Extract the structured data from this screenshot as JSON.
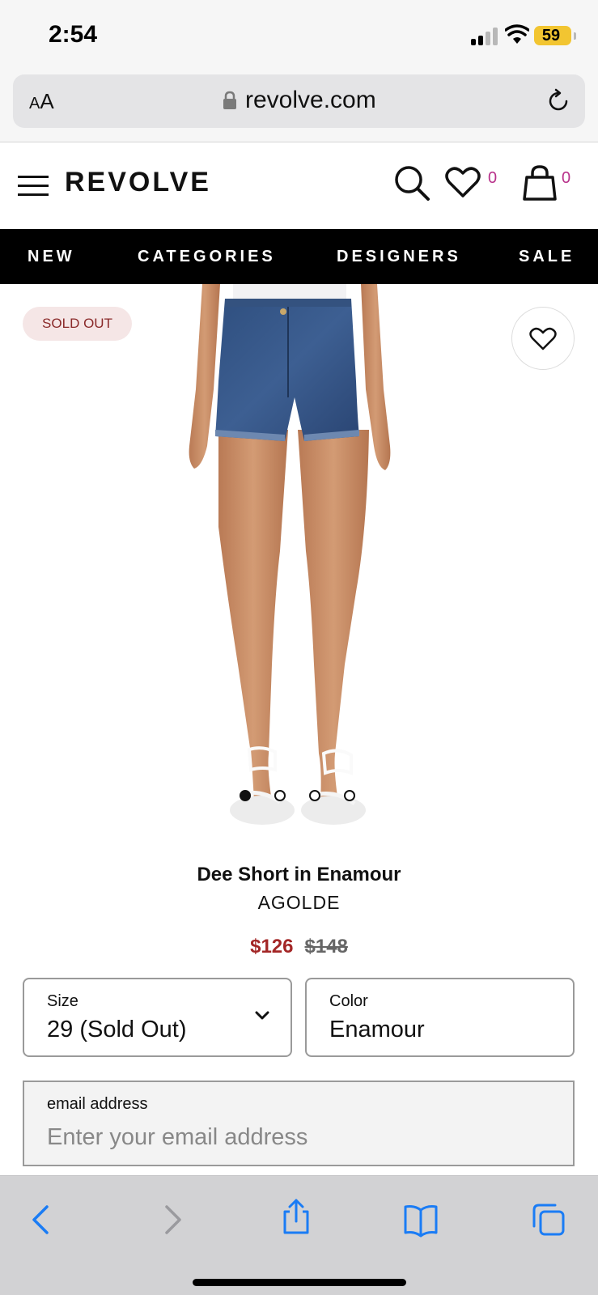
{
  "status_bar": {
    "time": "2:54",
    "battery": "59"
  },
  "browser": {
    "aa_label_a": "A",
    "aa_label_b": "A",
    "url": "revolve.com"
  },
  "header": {
    "logo": "REVOLVE",
    "wishlist_count": "0",
    "bag_count": "0"
  },
  "nav": {
    "items": [
      "NEW",
      "CATEGORIES",
      "DESIGNERS",
      "SALE"
    ]
  },
  "product_image": {
    "badge": "SOLD OUT",
    "dots_total": 4,
    "dots_active": 1
  },
  "product": {
    "name": "Dee Short in Enamour",
    "brand": "AGOLDE",
    "sale_price": "$126",
    "original_price": "$148"
  },
  "size_select": {
    "label": "Size",
    "value": "29 (Sold Out)"
  },
  "color_select": {
    "label": "Color",
    "value": "Enamour"
  },
  "email": {
    "label": "email address",
    "placeholder": "Enter your email address"
  },
  "colors": {
    "accent": "#a32626",
    "count": "#b8318a",
    "ios_blue": "#1a7cf5",
    "nav_bg": "#000000"
  }
}
